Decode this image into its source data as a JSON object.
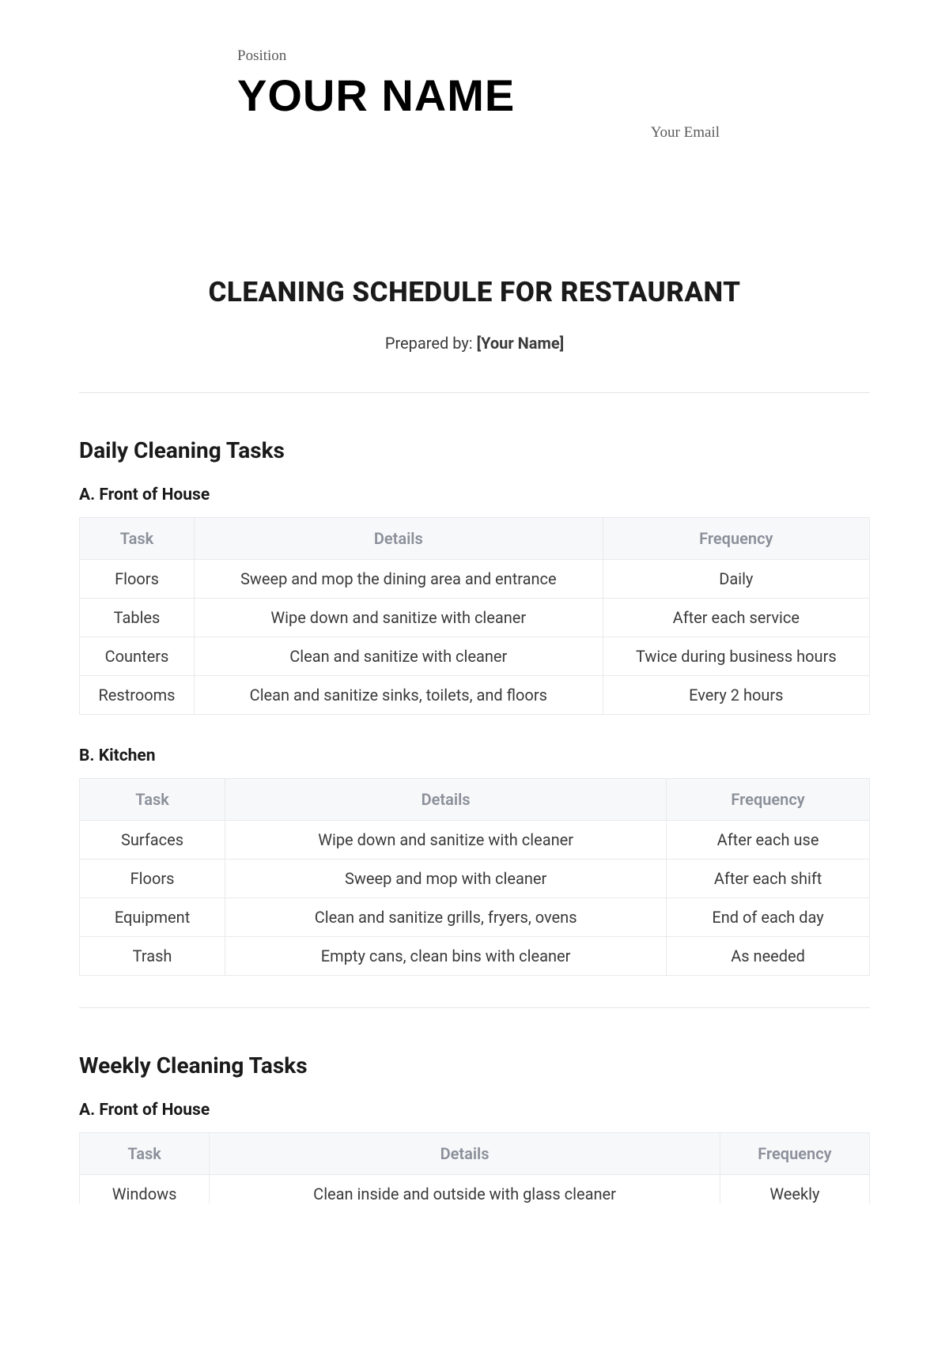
{
  "header": {
    "position": "Position",
    "name": "YOUR NAME",
    "email": "Your Email"
  },
  "doc": {
    "title": "CLEANING SCHEDULE FOR RESTAURANT",
    "prepared_label": "Prepared by: ",
    "prepared_value": "[Your Name]"
  },
  "section_daily": {
    "heading": "Daily Cleaning Tasks",
    "sub_a": {
      "heading": "A. Front of House",
      "cols": {
        "c1": "Task",
        "c2": "Details",
        "c3": "Frequency"
      },
      "rows": [
        {
          "task": "Floors",
          "details": "Sweep and mop the dining area and entrance",
          "freq": "Daily"
        },
        {
          "task": "Tables",
          "details": "Wipe down and sanitize with cleaner",
          "freq": "After each service"
        },
        {
          "task": "Counters",
          "details": "Clean and sanitize with cleaner",
          "freq": "Twice during business hours"
        },
        {
          "task": "Restrooms",
          "details": "Clean and sanitize sinks, toilets, and floors",
          "freq": "Every 2 hours"
        }
      ]
    },
    "sub_b": {
      "heading": "B. Kitchen",
      "cols": {
        "c1": "Task",
        "c2": "Details",
        "c3": "Frequency"
      },
      "rows": [
        {
          "task": "Surfaces",
          "details": "Wipe down and sanitize with cleaner",
          "freq": "After each use"
        },
        {
          "task": "Floors",
          "details": "Sweep and mop with cleaner",
          "freq": "After each shift"
        },
        {
          "task": "Equipment",
          "details": "Clean and sanitize grills, fryers, ovens",
          "freq": "End of each day"
        },
        {
          "task": "Trash",
          "details": "Empty cans, clean bins with cleaner",
          "freq": "As needed"
        }
      ]
    }
  },
  "section_weekly": {
    "heading": "Weekly Cleaning Tasks",
    "sub_a": {
      "heading": "A. Front of House",
      "cols": {
        "c1": "Task",
        "c2": "Details",
        "c3": "Frequency"
      },
      "rows": [
        {
          "task": "Windows",
          "details": "Clean inside and outside with glass cleaner",
          "freq": "Weekly"
        }
      ]
    }
  }
}
